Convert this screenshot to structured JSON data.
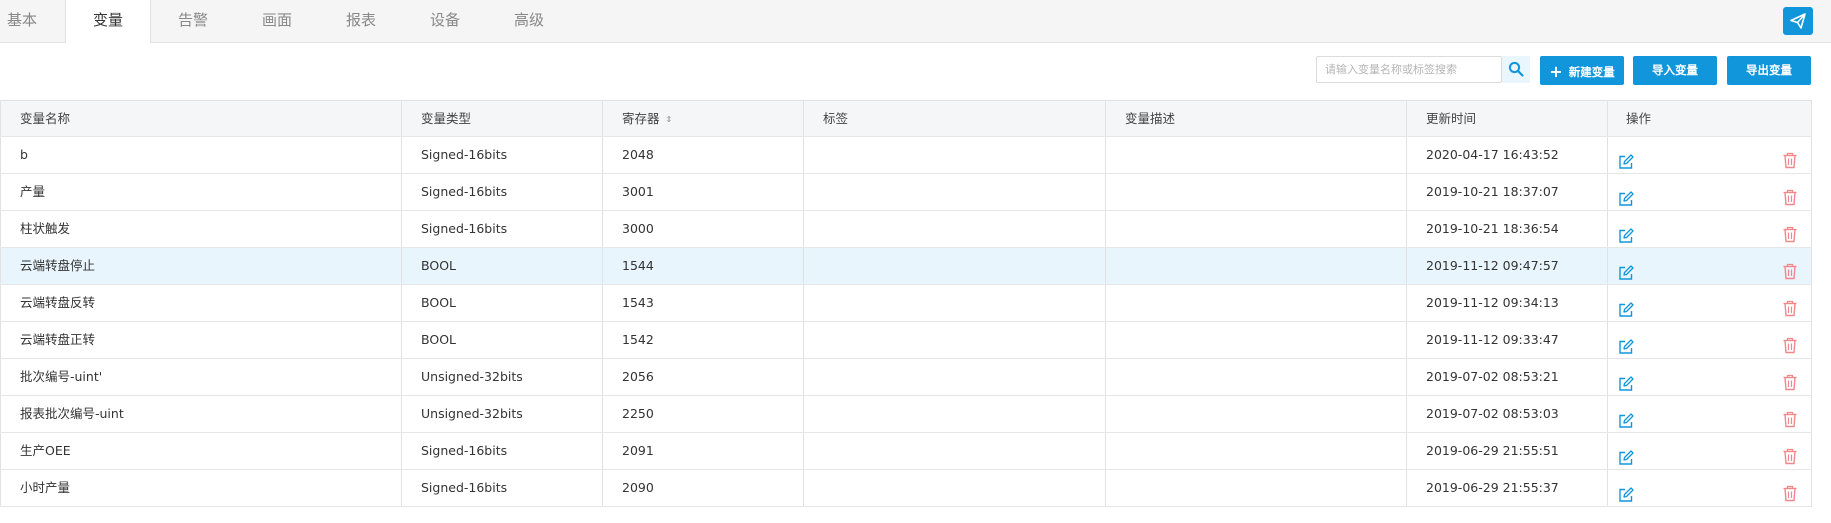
{
  "tabs": [
    {
      "label": "基本",
      "active": false
    },
    {
      "label": "变量",
      "active": true
    },
    {
      "label": "告警",
      "active": false
    },
    {
      "label": "画面",
      "active": false
    },
    {
      "label": "报表",
      "active": false
    },
    {
      "label": "设备",
      "active": false
    },
    {
      "label": "高级",
      "active": false
    }
  ],
  "header_action_icon": "send-icon",
  "toolbar": {
    "search_placeholder": "请输入变量名称或标签搜索",
    "search_value": "",
    "search_icon": "search-icon",
    "new_variable_label": "新建变量",
    "import_label": "导入变量",
    "export_label": "导出变量"
  },
  "table": {
    "columns": [
      "变量名称",
      "变量类型",
      "寄存器",
      "标签",
      "变量描述",
      "更新时间",
      "操作"
    ],
    "sortable_column": "寄存器",
    "highlighted_row": 3,
    "rows": [
      {
        "name": "b",
        "type": "Signed-16bits",
        "register": "2048",
        "tag": "",
        "desc": "",
        "updated": "2020-04-17 16:43:52"
      },
      {
        "name": "产量",
        "type": "Signed-16bits",
        "register": "3001",
        "tag": "",
        "desc": "",
        "updated": "2019-10-21 18:37:07"
      },
      {
        "name": "柱状触发",
        "type": "Signed-16bits",
        "register": "3000",
        "tag": "",
        "desc": "",
        "updated": "2019-10-21 18:36:54"
      },
      {
        "name": "云端转盘停止",
        "type": "BOOL",
        "register": "1544",
        "tag": "",
        "desc": "",
        "updated": "2019-11-12 09:47:57"
      },
      {
        "name": "云端转盘反转",
        "type": "BOOL",
        "register": "1543",
        "tag": "",
        "desc": "",
        "updated": "2019-11-12 09:34:13"
      },
      {
        "name": "云端转盘正转",
        "type": "BOOL",
        "register": "1542",
        "tag": "",
        "desc": "",
        "updated": "2019-11-12 09:33:47"
      },
      {
        "name": "批次编号-uint'",
        "type": "Unsigned-32bits",
        "register": "2056",
        "tag": "",
        "desc": "",
        "updated": "2019-07-02 08:53:21"
      },
      {
        "name": "报表批次编号-uint",
        "type": "Unsigned-32bits",
        "register": "2250",
        "tag": "",
        "desc": "",
        "updated": "2019-07-02 08:53:03"
      },
      {
        "name": "生产OEE",
        "type": "Signed-16bits",
        "register": "2091",
        "tag": "",
        "desc": "",
        "updated": "2019-06-29 21:55:51"
      },
      {
        "name": "小时产量",
        "type": "Signed-16bits",
        "register": "2090",
        "tag": "",
        "desc": "",
        "updated": "2019-06-29 21:55:37"
      }
    ],
    "row_actions": [
      "edit-icon",
      "delete-icon"
    ]
  },
  "colors": {
    "accent": "#1296db",
    "delete": "#f0888a",
    "highlight_row": "#e9f5fc"
  }
}
